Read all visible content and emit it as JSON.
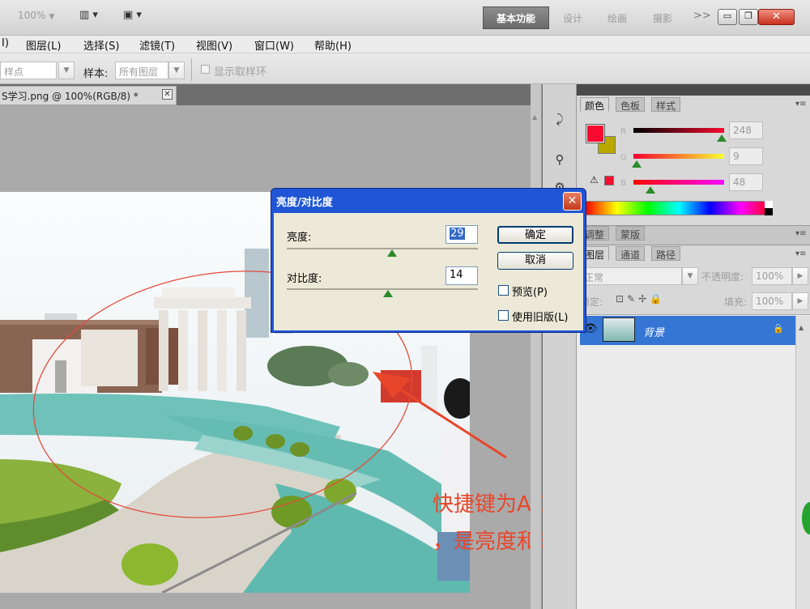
{
  "titlebar": {
    "zoom": "100%",
    "workspace_active": "基本功能",
    "workspaces": [
      "设计",
      "绘画",
      "摄影"
    ],
    "more": ">>"
  },
  "menu": [
    "I)",
    "图层(L)",
    "选择(S)",
    "滤镜(T)",
    "视图(V)",
    "窗口(W)",
    "帮助(H)"
  ],
  "options": {
    "point_value": "样点",
    "sample_label": "样本:",
    "sample_value": "所有图层",
    "show_ring_label": "显示取样环"
  },
  "document": {
    "tab_title": "S学习.png @ 100%(RGB/8) *"
  },
  "color_panel": {
    "tabs": [
      "颜色",
      "色板",
      "样式"
    ],
    "channels": [
      {
        "label": "R",
        "value": "248",
        "fraction": 0.97
      },
      {
        "label": "G",
        "value": "9",
        "fraction": 0.035
      },
      {
        "label": "B",
        "value": "48",
        "fraction": 0.19
      }
    ],
    "fg_color": "#f80930",
    "bg_color": "#b8a800"
  },
  "adjust_panel": {
    "tabs": [
      "调整",
      "蒙版"
    ]
  },
  "layers_panel": {
    "tabs": [
      "图层",
      "通道",
      "路径"
    ],
    "blend_mode": "正常",
    "opacity_label": "不透明度:",
    "opacity_value": "100%",
    "lock_label": "锁定:",
    "fill_label": "填充:",
    "fill_value": "100%",
    "layers": [
      {
        "name": "背景"
      }
    ]
  },
  "dialog": {
    "title": "亮度/对比度",
    "brightness_label": "亮度:",
    "brightness_value": "29",
    "brightness_fraction": 0.55,
    "contrast_label": "对比度:",
    "contrast_value": "14",
    "contrast_fraction": 0.53,
    "ok_label": "确定",
    "cancel_label": "取消",
    "preview_label": "预览(P)",
    "legacy_label": "使用旧版(L)"
  },
  "annotation": {
    "line1": "快捷键为ALT+I，按下A，按下C",
    "line2": "，是亮度和对比度的快捷键"
  },
  "colors": {
    "accent_red": "#e8462a",
    "dialog_blue": "#2055d6",
    "layer_selected": "#3575d4"
  }
}
